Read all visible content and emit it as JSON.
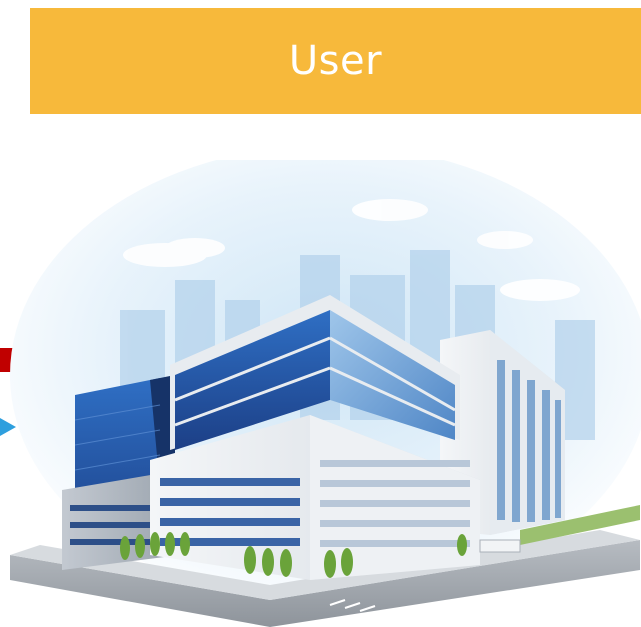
{
  "banner": {
    "title": "User",
    "color": "#f7b93b"
  },
  "markers": {
    "red_color": "#c00000",
    "blue_color": "#2e9fde"
  },
  "illustration": {
    "icon": "office-building-icon"
  }
}
